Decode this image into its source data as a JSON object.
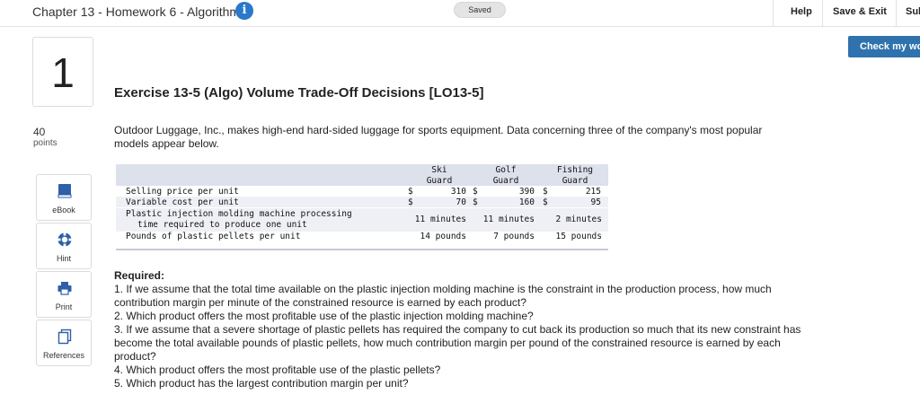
{
  "header": {
    "chapter_title": "Chapter 13 - Homework 6 - Algorithmic",
    "saved_label": "Saved",
    "help_label": "Help",
    "save_exit_label": "Save & Exit",
    "submit_label": "Sul"
  },
  "check_button": {
    "label": "Check my wo"
  },
  "question": {
    "number": "1",
    "points_value": "40",
    "points_label": "points"
  },
  "tools": [
    {
      "label": "eBook",
      "icon": "book-icon"
    },
    {
      "label": "Hint",
      "icon": "lifebuoy-icon"
    },
    {
      "label": "Print",
      "icon": "printer-icon"
    },
    {
      "label": "References",
      "icon": "document-icon"
    }
  ],
  "exercise": {
    "title": "Exercise 13-5 (Algo) Volume Trade-Off Decisions [LO13-5]",
    "intro": "Outdoor Luggage, Inc., makes high-end hard-sided luggage for sports equipment. Data concerning three of the company's most popular models appear below."
  },
  "table": {
    "columns": [
      {
        "line1": "Ski",
        "line2": "Guard"
      },
      {
        "line1": "Golf",
        "line2": "Guard"
      },
      {
        "line1": "Fishing",
        "line2": "Guard"
      }
    ],
    "rows": [
      {
        "label": "Selling price per unit",
        "currency": "$",
        "values": [
          "310",
          "390",
          "215"
        ]
      },
      {
        "label": "Variable cost per unit",
        "currency": "$",
        "values": [
          "70",
          "160",
          "95"
        ]
      },
      {
        "label_line1": "Plastic injection molding machine processing",
        "label_line2": "time required to produce one unit",
        "values": [
          "11 minutes",
          "11 minutes",
          "2 minutes"
        ]
      },
      {
        "label": "Pounds of plastic pellets per unit",
        "values": [
          "14 pounds",
          "7 pounds",
          "15 pounds"
        ]
      }
    ]
  },
  "required": {
    "heading": "Required:",
    "items": [
      "1. If we assume that the total time available on the plastic injection molding machine is the constraint in the production process, how much contribution margin per minute of the constrained resource is earned by each product?",
      "2. Which product offers the most profitable use of the plastic injection molding machine?",
      "3. If we assume that a severe shortage of plastic pellets has required the company to cut back its production so much that its new constraint has become the total available pounds of plastic pellets, how much contribution margin per pound of the constrained resource is earned by each product?",
      "4. Which product offers the most profitable use of the plastic pellets?",
      "5. Which product has the largest contribution margin per unit?"
    ]
  },
  "colors": {
    "accent_blue": "#2f72ad",
    "info_blue": "#2a78c9",
    "table_header_band": "#dde1ec",
    "table_row_band": "#eef0f5"
  }
}
